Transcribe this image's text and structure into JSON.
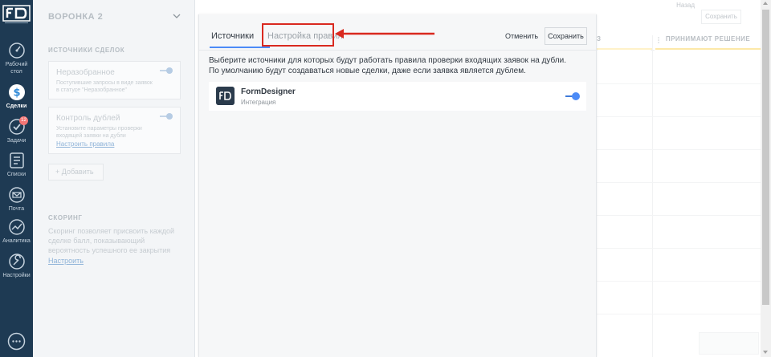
{
  "nav": {
    "items": [
      {
        "label": "Рабочий стол",
        "icon": "dashboard-icon"
      },
      {
        "label": "Сделки",
        "icon": "deals-icon",
        "active": true
      },
      {
        "label": "Задачи",
        "icon": "tasks-icon",
        "badge": "12"
      },
      {
        "label": "Списки",
        "icon": "lists-icon"
      },
      {
        "label": "Почта",
        "icon": "mail-icon"
      },
      {
        "label": "Аналитика",
        "icon": "analytics-icon"
      },
      {
        "label": "Настройки",
        "icon": "settings-icon"
      }
    ]
  },
  "panel": {
    "title": "ВОРОНКА 2",
    "sources_heading": "ИСТОЧНИКИ СДЕЛОК",
    "unsorted": {
      "title": "Неразобранное",
      "desc": "Поступившие запросы в виде заявок в статусе \"Неразобранное\""
    },
    "duplicates": {
      "title": "Контроль дублей",
      "desc": "Установите параметры проверки входящей заявки на дубли",
      "link": "Настроить правила"
    },
    "add_label": "Добавить",
    "scoring_heading": "СКОРИНГ",
    "scoring_text": "Скоринг позволяет присвоить каждой сделке балл, показывающий вероятность успешного ее закрытия",
    "scoring_link": "Настроить"
  },
  "board": {
    "back_label": "Назад",
    "save_label": "Сохранить",
    "col_partial": "З",
    "col_title": "ПРИНИМАЮТ РЕШЕНИЕ",
    "plus": "+"
  },
  "modal": {
    "tab_sources": "Источники",
    "tab_rules": "Настройка правил",
    "cancel_label": "Отменить",
    "save_label": "Сохранить",
    "desc_line1": "Выберите источники для которых будут работать правила проверки входящих заявок на дубли.",
    "desc_line2": "По умолчанию будут создаваться новые сделки, даже если заявка является дублем.",
    "source": {
      "name": "FormDesigner",
      "type": "Интеграция",
      "enabled": true
    }
  },
  "colors": {
    "nav_bg": "#1e3a53",
    "accent": "#4c8bf7",
    "highlight": "#d9291f",
    "badge": "#f37575",
    "col_line_left": "#fff2c9",
    "col_line_right": "#fde8a8"
  }
}
